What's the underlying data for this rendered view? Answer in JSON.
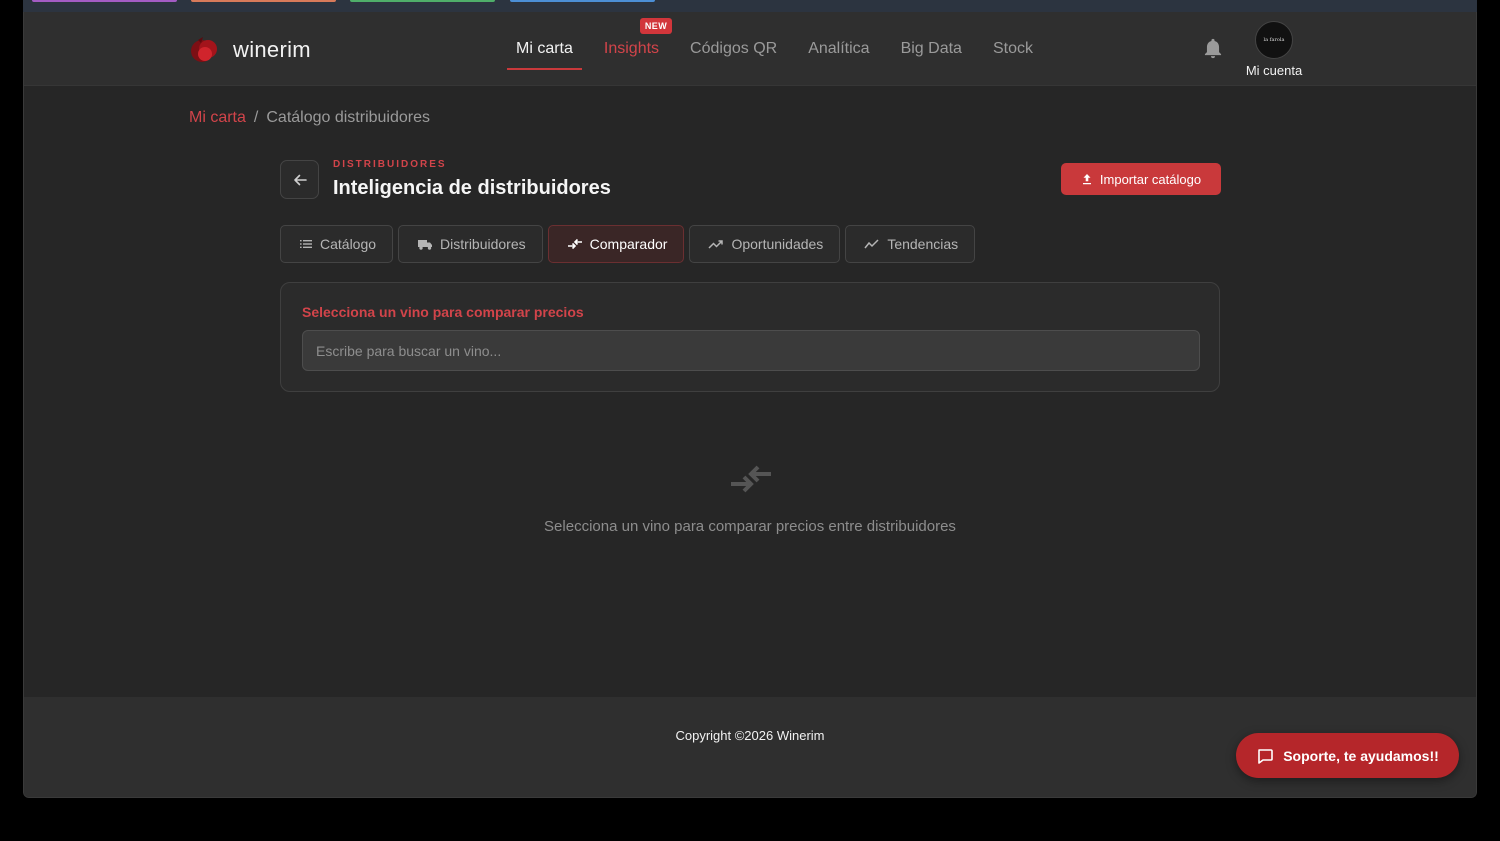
{
  "colors": {
    "accent": "#c9393b",
    "background": "#262626",
    "header": "#2f2f2f"
  },
  "top_strip": {
    "pill_colors": [
      "#a35cc4",
      "#d77a5a",
      "#4fae6a",
      "#4c8fd6"
    ]
  },
  "brand": {
    "name": "winerim",
    "logo_icon": "wine-glass-logo"
  },
  "nav": {
    "items": [
      {
        "label": "Mi carta",
        "active": true
      },
      {
        "label": "Insights",
        "badge": "NEW"
      },
      {
        "label": "Códigos QR"
      },
      {
        "label": "Analítica"
      },
      {
        "label": "Big Data"
      },
      {
        "label": "Stock"
      }
    ]
  },
  "account": {
    "label": "Mi cuenta",
    "avatar_text": "la farola",
    "bell_icon": "bell-icon"
  },
  "breadcrumb": {
    "root": "Mi carta",
    "separator": "/",
    "current": "Catálogo distribuidores"
  },
  "page": {
    "eyebrow": "DISTRIBUIDORES",
    "title": "Inteligencia de distribuidores",
    "import_button": "Importar catálogo"
  },
  "tabs": [
    {
      "label": "Catálogo",
      "icon": "list-icon"
    },
    {
      "label": "Distribuidores",
      "icon": "truck-icon"
    },
    {
      "label": "Comparador",
      "icon": "compare-arrows-icon",
      "active": true
    },
    {
      "label": "Oportunidades",
      "icon": "trending-up-icon"
    },
    {
      "label": "Tendencias",
      "icon": "trend-line-icon"
    }
  ],
  "compare": {
    "label": "Selecciona un vino para comparar precios",
    "search_placeholder": "Escribe para buscar un vino...",
    "search_value": ""
  },
  "empty_state": {
    "icon": "compare-arrows-icon",
    "text": "Selecciona un vino para comparar precios entre distribuidores"
  },
  "footer": {
    "copyright": "Copyright ©2026 Winerim"
  },
  "support": {
    "label": "Soporte, te ayudamos!!",
    "icon": "chat-icon"
  }
}
